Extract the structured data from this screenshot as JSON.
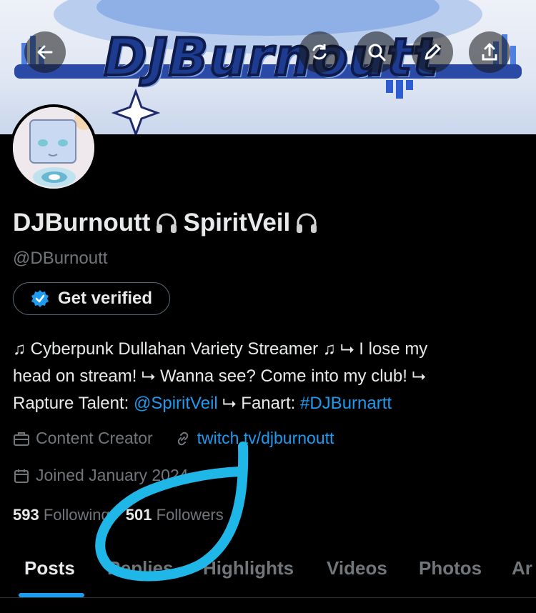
{
  "banner": {
    "title": "DJBurnoutt"
  },
  "nav": {
    "back": "back-icon",
    "refresh": "refresh-icon",
    "search": "search-icon",
    "edit": "edit-icon",
    "share": "share-icon"
  },
  "profile": {
    "display_name": "DJBurnoutt",
    "display_name_suffix": "SpiritVeil",
    "handle": "@DBurnoutt",
    "verify_button": "Get verified",
    "bio_line1": "♫ Cyberpunk Dullahan Variety Streamer ♫ ⮡ I lose my",
    "bio_line2": "head on stream! ⮡ Wanna see? Come into my club! ⮡",
    "bio_line3_prefix": "Rapture Talent: ",
    "bio_mention": "@SpiritVeil",
    "bio_line3_mid": " ⮡ Fanart: ",
    "bio_hashtag": "#DJBurnartt",
    "category": "Content Creator",
    "website": "twitch.tv/djburnoutt",
    "joined": "Joined January 2024",
    "following_count": "593",
    "following_label": "Following",
    "followers_count": "501",
    "followers_label": "Followers"
  },
  "tabs": [
    {
      "label": "Posts",
      "active": true
    },
    {
      "label": "Replies",
      "active": false
    },
    {
      "label": "Highlights",
      "active": false
    },
    {
      "label": "Videos",
      "active": false
    },
    {
      "label": "Photos",
      "active": false
    },
    {
      "label": "Ar",
      "active": false
    }
  ],
  "colors": {
    "accent": "#1d9bf0",
    "muted": "#71767b",
    "text": "#e7e9ea",
    "scribble": "#1fb6e8"
  }
}
